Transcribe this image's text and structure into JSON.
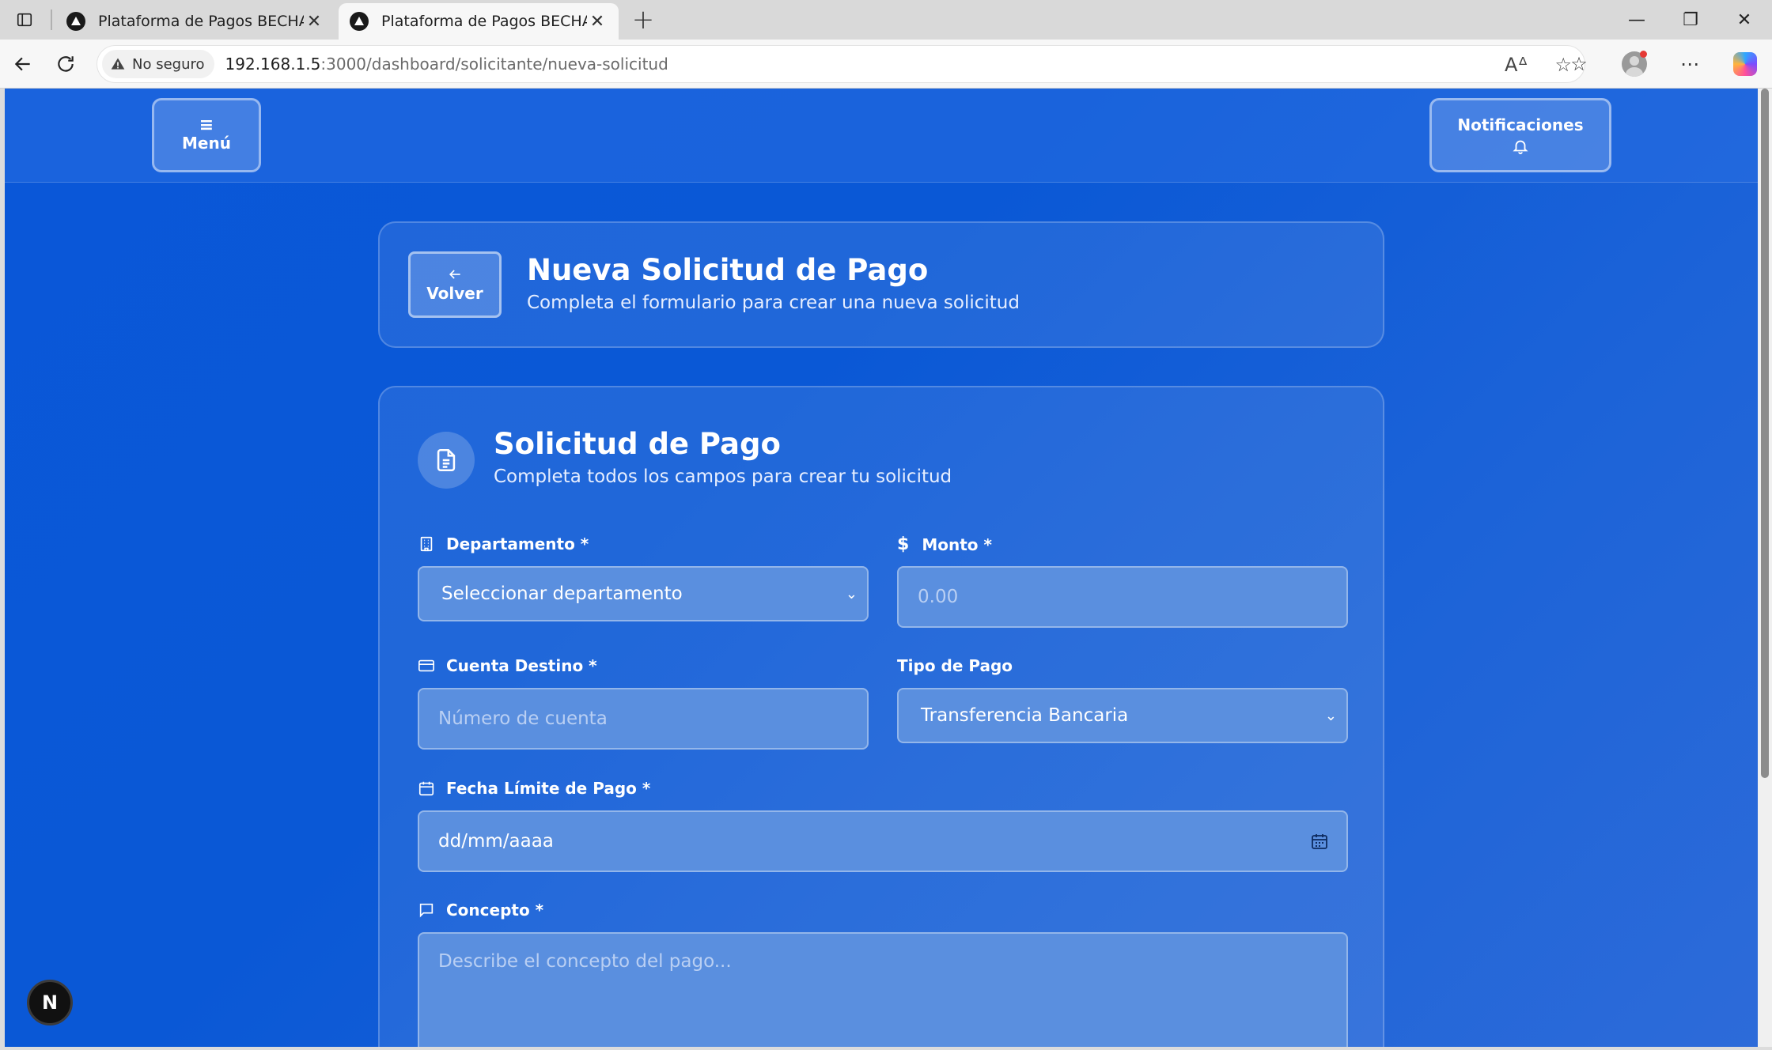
{
  "browser": {
    "tabs": [
      {
        "title": "Plataforma de Pagos BECHAPRA",
        "active": false
      },
      {
        "title": "Plataforma de Pagos BECHAPRA",
        "active": true
      }
    ],
    "security_label": "No seguro",
    "url_host": "192.168.1.5",
    "url_rest": ":3000/dashboard/solicitante/nueva-solicitud"
  },
  "topnav": {
    "menu_label": "Menú",
    "notifications_label": "Notificaciones"
  },
  "header": {
    "back_label": "Volver",
    "title": "Nueva Solicitud de Pago",
    "subtitle": "Completa el formulario para crear una nueva solicitud"
  },
  "form": {
    "title": "Solicitud de Pago",
    "subtitle": "Completa todos los campos para crear tu solicitud",
    "departamento": {
      "label": "Departamento *",
      "value": "Seleccionar departamento"
    },
    "monto": {
      "label": "Monto *",
      "placeholder": "0.00"
    },
    "cuenta": {
      "label": "Cuenta Destino *",
      "placeholder": "Número de cuenta"
    },
    "tipo_pago": {
      "label": "Tipo de Pago",
      "value": "Transferencia Bancaria"
    },
    "fecha": {
      "label": "Fecha Límite de Pago *",
      "value": "dd/mm/aaaa"
    },
    "concepto": {
      "label": "Concepto *",
      "placeholder": "Describe el concepto del pago..."
    }
  },
  "dev_badge": "N",
  "colors": {
    "page_bg": "#0a57d8",
    "field_bg": "#5a8fdf",
    "placeholder": "#b9cff3"
  }
}
